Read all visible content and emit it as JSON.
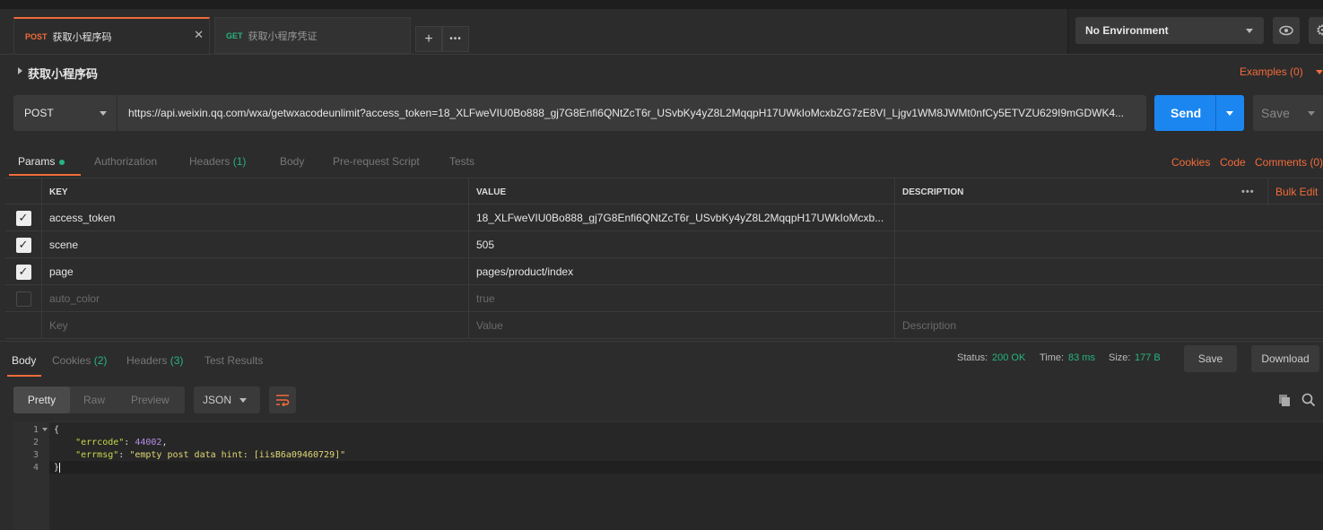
{
  "tabs": [
    {
      "method": "POST",
      "title": "获取小程序码",
      "active": true
    },
    {
      "method": "GET",
      "title": "获取小程序凭证",
      "active": false
    }
  ],
  "tab_actions": {
    "new_tab": "+",
    "more": "•••"
  },
  "environment": {
    "selected": "No Environment"
  },
  "request": {
    "name": "获取小程序码",
    "examples": "Examples (0)",
    "method": "POST",
    "url": "https://api.weixin.qq.com/wxa/getwxacodeunlimit?access_token=18_XLFweVIU0Bo888_gj7G8Enfi6QNtZcT6r_USvbKy4yZ8L2MqqpH17UWkIoMcxbZG7zE8VI_Ljgv1WM8JWMt0nfCy5ETVZU629I9mGDWK4...",
    "send": "Send",
    "save": "Save"
  },
  "request_tabs": {
    "params": "Params",
    "authorization": "Authorization",
    "headers": "Headers",
    "headers_count": "(1)",
    "body": "Body",
    "prerequest": "Pre-request Script",
    "tests": "Tests",
    "cookies": "Cookies",
    "code": "Code",
    "comments": "Comments (0)"
  },
  "params_table": {
    "headers": {
      "key": "KEY",
      "value": "VALUE",
      "description": "DESCRIPTION",
      "more": "•••",
      "bulk_edit": "Bulk Edit"
    },
    "rows": [
      {
        "key": "access_token",
        "value": "18_XLFweVIU0Bo888_gj7G8Enfi6QNtZcT6r_USvbKy4yZ8L2MqqpH17UWkIoMcxb...",
        "checked": true
      },
      {
        "key": "scene",
        "value": "505",
        "checked": true
      },
      {
        "key": "page",
        "value": "pages/product/index",
        "checked": true
      },
      {
        "key": "auto_color",
        "value": "true",
        "checked": false
      }
    ],
    "placeholder": {
      "key": "Key",
      "value": "Value",
      "description": "Description"
    }
  },
  "response": {
    "tabs": {
      "body": "Body",
      "cookies": "Cookies",
      "cookies_count": "(2)",
      "headers": "Headers",
      "headers_count": "(3)",
      "test_results": "Test Results"
    },
    "status_label": "Status:",
    "status": "200 OK",
    "time_label": "Time:",
    "time": "83 ms",
    "size_label": "Size:",
    "size": "177 B",
    "save": "Save",
    "download": "Download",
    "view_modes": {
      "pretty": "Pretty",
      "raw": "Raw",
      "preview": "Preview"
    },
    "format": "JSON",
    "lines": [
      "1",
      "2",
      "3",
      "4"
    ],
    "json": {
      "open": "{",
      "errcode_key": "\"errcode\"",
      "errcode_val": "44002",
      "errmsg_key": "\"errmsg\"",
      "errmsg_val": "\"empty post data hint: [iisB6a09460729]\"",
      "close": "}"
    }
  },
  "colors": {
    "accent": "#f26b3a",
    "send": "#1b86f0",
    "success": "#26b47f"
  }
}
